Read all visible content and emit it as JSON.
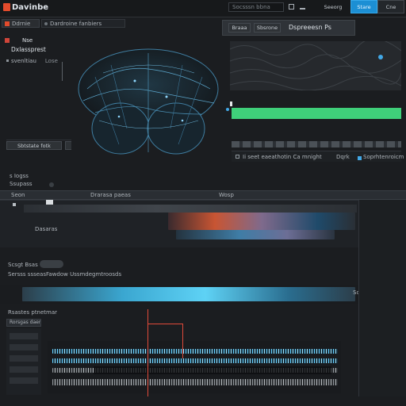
{
  "app": {
    "title": "Davinbe",
    "logo_color": "#e34b2c",
    "accent": "#1c8fd4"
  },
  "topbar": {
    "tab1": "Ddrnie",
    "tab2": "Dardroine fanbiers",
    "search_placeholder": "Socsssn bbna",
    "btn_save": "Seeorg",
    "btn_primary": "Stare",
    "btn_secondary": "Cne"
  },
  "inspector": {
    "heading": "Nse",
    "subheading": "Dxlassprest",
    "row1": "svenltiau",
    "row1b": "Lose",
    "btn_apply": "Sbtstate fotk",
    "lower_label1": "s Iogss",
    "lower_label2": "Ssupass"
  },
  "viewer": {
    "tab_a": "Braaa",
    "tab_b": "Sbsrone",
    "title": "Dspreeesn Ps",
    "status_text": "Ii seet eaeathotin Ca mnight",
    "status_right": "Dqrk",
    "status_right2": "Soprhtenroicm",
    "green_bar_color": "#3fd07a"
  },
  "timeline": {
    "header_left": "Seon",
    "header_mid": "Drarasa paeas",
    "header_right": "Wosp",
    "track1_label": "Dasaras",
    "track2_label": "Scsgt Bsas",
    "track3_label": "Sersss ssseas",
    "track3_value": "Fawdow Ussmdegmtroosds",
    "track4_label": "Rsastes ptnetmar",
    "track4_right": "Sonate",
    "mixer_label": "Rorsgas daer",
    "playhead_color": "#e04a3a"
  }
}
